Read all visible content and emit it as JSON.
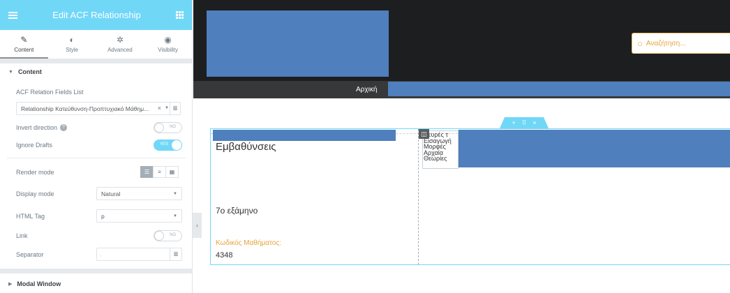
{
  "panel": {
    "title": "Edit ACF Relationship",
    "tabs": [
      {
        "label": "Content",
        "icon": "pencil-icon",
        "glyph": "✎"
      },
      {
        "label": "Style",
        "icon": "contrast-icon",
        "glyph": "◐"
      },
      {
        "label": "Advanced",
        "icon": "gear-icon",
        "glyph": "✲"
      },
      {
        "label": "Visibility",
        "icon": "eye-icon",
        "glyph": "◉"
      }
    ],
    "content_section": "Content",
    "modal_section": "Modal Window",
    "fields": {
      "relation_list_label": "ACF Relation Fields List",
      "relation_list_value": "Relationship Κατεύθυνση-Προπτυχιακό Μάθημ...",
      "invert_direction_label": "Invert direction",
      "invert_direction_state": "NO",
      "ignore_drafts_label": "Ignore Drafts",
      "ignore_drafts_state": "YES",
      "render_mode_label": "Render mode",
      "display_mode_label": "Display mode",
      "display_mode_value": "Natural",
      "html_tag_label": "HTML Tag",
      "html_tag_value": "p",
      "link_label": "Link",
      "link_state": "NO",
      "separator_label": "Separator",
      "separator_value": ","
    }
  },
  "preview": {
    "search_placeholder": "Αναζήτηση...",
    "nav_home": "Αρχική",
    "heading": "Εμβαθύνσεις",
    "semester": "7ο εξάμηνο",
    "code_label": "Κωδικός Μαθήματος:",
    "code_value": "4348",
    "relationship_items": [
      "Νευρές τ",
      "Εισαγωγή",
      "Μορφές",
      "Αρχαία",
      "Θεωρίες"
    ],
    "section_handle": {
      "add": "+",
      "move": "⠿",
      "close": "×"
    }
  },
  "colors": {
    "accent": "#71d7f7",
    "placeholder_block": "#4f7fbd",
    "header_bg": "#1d1e1f",
    "nav_bg": "#36383a",
    "orange": "#e8a23a"
  }
}
